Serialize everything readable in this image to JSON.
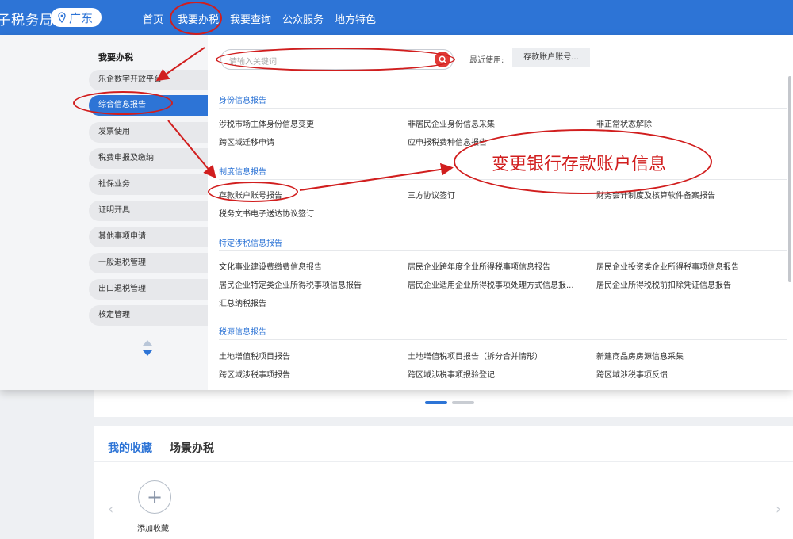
{
  "header": {
    "brand": "子税务局",
    "location": "广东",
    "nav": [
      "首页",
      "我要办税",
      "我要查询",
      "公众服务",
      "地方特色"
    ]
  },
  "sidebar": {
    "title": "我要办税",
    "items": [
      "乐企数字开放平台",
      "综合信息报告",
      "发票使用",
      "税费申报及缴纳",
      "社保业务",
      "证明开具",
      "其他事项申请",
      "一般退税管理",
      "出口退税管理",
      "核定管理"
    ],
    "active_index": 1
  },
  "search": {
    "placeholder": "请输入关键词",
    "recent_label": "最近使用:",
    "recent_item": "存款账户账号..."
  },
  "sections": [
    {
      "title": "身份信息报告",
      "items": [
        "涉税市场主体身份信息变更",
        "非居民企业身份信息采集",
        "非正常状态解除",
        "跨区域迁移申请",
        "应申报税费种信息报告"
      ]
    },
    {
      "title": "制度信息报告",
      "items": [
        "存款账户账号报告",
        "三方协议签订",
        "财务会计制度及核算软件备案报告",
        "税务文书电子送达协议签订"
      ]
    },
    {
      "title": "特定涉税信息报告",
      "items": [
        "文化事业建设费缴费信息报告",
        "居民企业跨年度企业所得税事项信息报告",
        "居民企业投资类企业所得税事项信息报告",
        "居民企业特定类企业所得税事项信息报告",
        "居民企业适用企业所得税事项处理方式信息报...",
        "居民企业所得税税前扣除凭证信息报告",
        "汇总纳税报告"
      ]
    },
    {
      "title": "税源信息报告",
      "items": [
        "土地增值税项目报告",
        "土地增值税项目报告（拆分合并情形）",
        "新建商品房房源信息采集",
        "跨区域涉税事项报告",
        "跨区域涉税事项报验登记",
        "跨区域涉税事项反馈"
      ]
    }
  ],
  "annotation": {
    "text": "变更银行存款账户信息",
    "color": "#d11e1e"
  },
  "favorites": {
    "tabs": [
      "我的收藏",
      "场景办税"
    ],
    "add_label": "添加收藏",
    "add_icon": "plus-icon"
  },
  "colors": {
    "brand_blue": "#2d74d6",
    "annotation_red": "#d11e1e"
  }
}
